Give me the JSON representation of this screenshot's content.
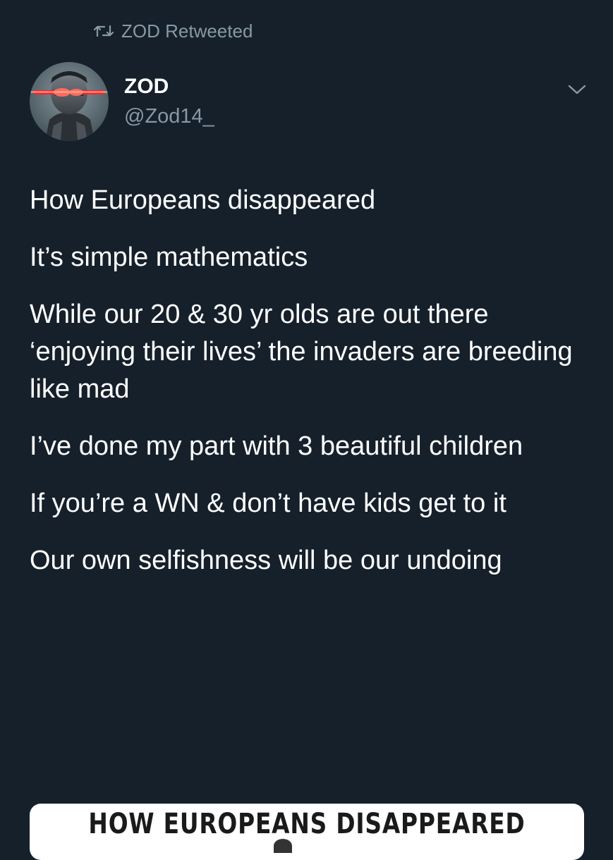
{
  "retweet": {
    "icon": "retweet-icon",
    "text": "ZOD Retweeted"
  },
  "author": {
    "name": "ZOD",
    "handle": "@Zod14_",
    "avatar_icon": "avatar-icon"
  },
  "menu": {
    "icon": "chevron-down-icon"
  },
  "tweet": {
    "paragraphs": [
      "How Europeans disappeared",
      "It’s simple mathematics",
      "While our 20 & 30 yr olds are out there ‘enjoying their lives’ the invaders are breeding like mad",
      "I’ve done my part with 3 beautiful children",
      "If you’re a WN & don’t have kids get to it",
      "Our own selfishness will be our undoing"
    ]
  },
  "media": {
    "title": "HOW EUROPEANS DISAPPEARED"
  },
  "colors": {
    "background": "#15202b",
    "text": "#ffffff",
    "secondary_text": "#8899a6",
    "avatar_glow": "#ff1e1e"
  }
}
